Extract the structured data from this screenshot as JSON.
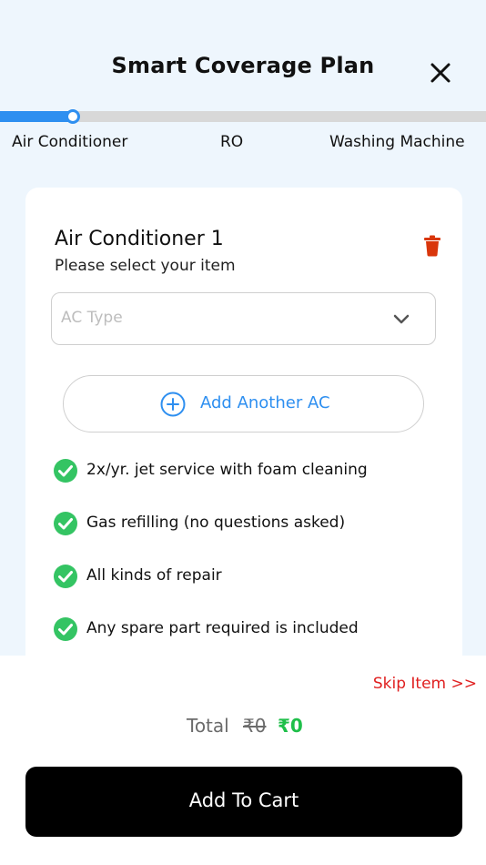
{
  "header": {
    "title": "Smart Coverage Plan",
    "close_icon": "close-icon"
  },
  "steps": {
    "items": [
      {
        "label": "Air Conditioner"
      },
      {
        "label": "RO"
      },
      {
        "label": "Washing Machine"
      }
    ],
    "progress_percent": 15
  },
  "card": {
    "title": "Air Conditioner 1",
    "subtitle": "Please select your item",
    "delete_icon": "trash-icon",
    "select": {
      "placeholder": "AC Type",
      "icon": "chevron-down-icon"
    },
    "add_button": {
      "label": "Add Another AC",
      "icon": "plus-circle-icon"
    },
    "features": [
      "2x/yr. jet service with foam cleaning",
      "Gas refilling (no questions asked)",
      "All kinds of repair",
      "Any spare part required is included"
    ]
  },
  "footer": {
    "skip_label": "Skip Item >>",
    "total_label": "Total",
    "total_old": "₹0",
    "total_new": "₹0",
    "cart_label": "Add To Cart"
  },
  "colors": {
    "accent": "#2e8ff0",
    "check": "#34c463",
    "delete": "#d9360b",
    "skip": "#e02020",
    "price": "#1fbf4a",
    "background": "#eef6fd"
  }
}
